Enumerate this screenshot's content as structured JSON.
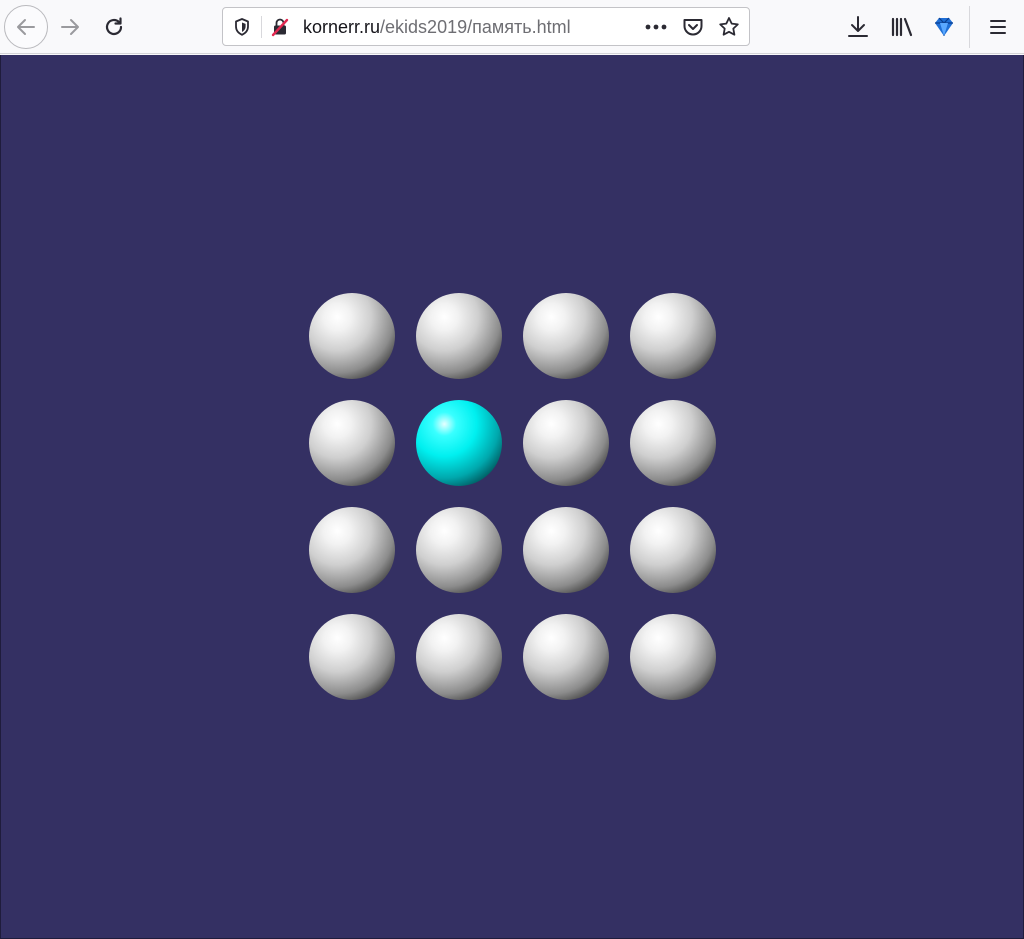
{
  "browser": {
    "url_host": "kornerr.ru",
    "url_path": "/ekids2019/память.html"
  },
  "icons": {
    "back": "arrow-left-icon",
    "forward": "arrow-right-icon",
    "reload": "reload-icon",
    "tracking_protection": "shield-icon",
    "insecure": "insecure-lock-icon",
    "page_actions": "more-dots-icon",
    "pocket": "pocket-icon",
    "bookmark": "star-icon",
    "downloads": "download-icon",
    "library": "library-icon",
    "extension": "diamond-extension-icon",
    "menu": "hamburger-menu-icon"
  },
  "game": {
    "rows": 4,
    "cols": 4,
    "lit_ball": [
      1,
      1
    ],
    "colors": {
      "background": "#343063",
      "ball": "#d0d0d0",
      "lit_ball": "#00ffff"
    }
  }
}
